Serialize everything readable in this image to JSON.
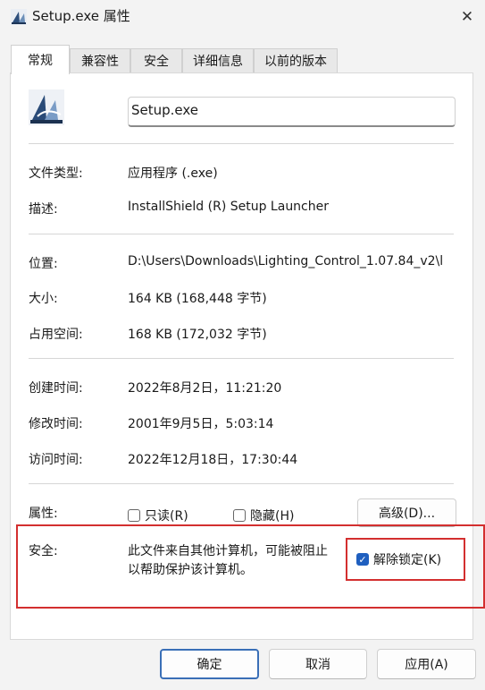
{
  "window": {
    "title": "Setup.exe 属性",
    "close_icon": "close-icon"
  },
  "tabs": [
    {
      "label": "常规"
    },
    {
      "label": "兼容性"
    },
    {
      "label": "安全"
    },
    {
      "label": "详细信息"
    },
    {
      "label": "以前的版本"
    }
  ],
  "general": {
    "file_name": "Setup.exe",
    "rows": {
      "file_type": {
        "label": "文件类型:",
        "value": "应用程序 (.exe)"
      },
      "description": {
        "label": "描述:",
        "value": "InstallShield (R) Setup Launcher"
      },
      "location": {
        "label": "位置:",
        "value": "D:\\Users\\Downloads\\Lighting_Control_1.07.84_v2\\l"
      },
      "size": {
        "label": "大小:",
        "value": "164 KB (168,448 字节)"
      },
      "size_on_disk": {
        "label": "占用空间:",
        "value": "168 KB (172,032 字节)"
      },
      "created": {
        "label": "创建时间:",
        "value": "2022年8月2日，11:21:20"
      },
      "modified": {
        "label": "修改时间:",
        "value": "2001年9月5日，5:03:14"
      },
      "accessed": {
        "label": "访问时间:",
        "value": "2022年12月18日，17:30:44"
      }
    },
    "attributes": {
      "label": "属性:",
      "readonly": {
        "label": "只读(R)",
        "checked": false
      },
      "hidden": {
        "label": "隐藏(H)",
        "checked": false
      },
      "advanced_button": "高级(D)..."
    },
    "security": {
      "label": "安全:",
      "message_line1": "此文件来自其他计算机，可能被阻止",
      "message_line2": "以帮助保护该计算机。",
      "unblock": {
        "label": "解除锁定(K)",
        "checked": true
      }
    }
  },
  "buttons": {
    "ok": "确定",
    "cancel": "取消",
    "apply": "应用(A)"
  },
  "colors": {
    "highlight_red": "#d32f2f",
    "checkbox_blue": "#1f5fbf"
  }
}
